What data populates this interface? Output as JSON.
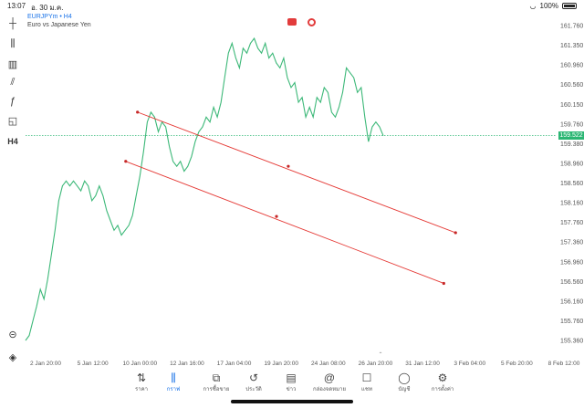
{
  "status": {
    "time": "13:07",
    "date": "อ. 30 ม.ค.",
    "battery": "100%"
  },
  "header": {
    "symbol": "EURJPYm • H4",
    "description": "Euro vs Japanese Yen"
  },
  "toolbar": [
    {
      "name": "crosshair-icon",
      "glyph": "┼"
    },
    {
      "name": "candles-icon",
      "glyph": "⫼"
    },
    {
      "name": "indicators-icon",
      "glyph": "▥"
    },
    {
      "name": "objects-icon",
      "glyph": "⫽"
    },
    {
      "name": "function-icon",
      "glyph": "ƒ"
    },
    {
      "name": "shapes-icon",
      "glyph": "◱"
    },
    {
      "name": "timeframe-button",
      "glyph": "H4"
    }
  ],
  "current_price": "159.522",
  "x_labels": [
    "2 Jan 20:00",
    "5 Jan 12:00",
    "10 Jan 00:00",
    "12 Jan 16:00",
    "17 Jan 04:00",
    "19 Jan 20:00",
    "24 Jan 08:00",
    "26 Jan 20:00",
    "31 Jan 12:00",
    "3 Feb 04:00",
    "5 Feb 20:00",
    "8 Feb 12:00"
  ],
  "y_labels": [
    "161.760",
    "161.350",
    "160.960",
    "160.560",
    "160.150",
    "159.760",
    "159.380",
    "158.960",
    "158.560",
    "158.160",
    "157.760",
    "157.360",
    "156.960",
    "156.560",
    "156.160",
    "155.760",
    "155.360"
  ],
  "chart_data": {
    "type": "line",
    "y_range": [
      155.36,
      161.76
    ],
    "series": [
      {
        "values": [
          155.36,
          155.46,
          155.76,
          156.05,
          156.4,
          156.2,
          156.6,
          157.1,
          157.6,
          158.2,
          158.5,
          158.6,
          158.5,
          158.6,
          158.5,
          158.4,
          158.6,
          158.5,
          158.2,
          158.3,
          158.5,
          158.3,
          158.0,
          157.8,
          157.6,
          157.7,
          157.5,
          157.6,
          157.7,
          157.9,
          158.3,
          158.7,
          159.2,
          159.8,
          160.0,
          159.9,
          159.6,
          159.8,
          159.7,
          159.3,
          159.0,
          158.9,
          159.0,
          158.8,
          158.9,
          159.1,
          159.4,
          159.6,
          159.7,
          159.9,
          159.8,
          160.1,
          159.9,
          160.2,
          160.7,
          161.2,
          161.4,
          161.1,
          160.9,
          161.3,
          161.2,
          161.4,
          161.5,
          161.3,
          161.2,
          161.4,
          161.1,
          161.2,
          161.0,
          160.9,
          161.1,
          160.7,
          160.5,
          160.6,
          160.2,
          160.3,
          159.9,
          160.1,
          159.9,
          160.3,
          160.2,
          160.5,
          160.4,
          160.0,
          159.9,
          160.1,
          160.4,
          160.9,
          160.8,
          160.7,
          160.4,
          160.5,
          159.9,
          159.4,
          159.7,
          159.8,
          159.7,
          159.52
        ]
      }
    ],
    "trendlines": [
      {
        "from": {
          "x": "9 Jan 08:00",
          "y": 160.0
        },
        "mid": {
          "x": "20 Jan 00:00",
          "y": 158.9
        },
        "to": {
          "x": "31 Jan 20:00",
          "y": 157.55
        }
      },
      {
        "from": {
          "x": "8 Jan 12:00",
          "y": 159.0
        },
        "mid": {
          "x": "19 Jan 04:00",
          "y": 157.88
        },
        "to": {
          "x": "31 Jan 00:00",
          "y": 156.52
        }
      }
    ]
  },
  "nav": [
    {
      "name": "nav-quotes",
      "icon": "⇅",
      "label": "ราคา"
    },
    {
      "name": "nav-chart",
      "icon": "⫼",
      "label": "กราฟ",
      "active": true
    },
    {
      "name": "nav-trade",
      "icon": "⧉",
      "label": "การซื้อขาย"
    },
    {
      "name": "nav-history",
      "icon": "↺",
      "label": "ประวัติ"
    },
    {
      "name": "nav-news",
      "icon": "▤",
      "label": "ข่าว"
    },
    {
      "name": "nav-mailbox",
      "icon": "@",
      "label": "กล่องจดหมาย"
    },
    {
      "name": "nav-chat",
      "icon": "☐",
      "label": "แชท"
    },
    {
      "name": "nav-account",
      "icon": "◯",
      "label": "บัญชี"
    },
    {
      "name": "nav-settings",
      "icon": "⚙",
      "label": "การตั้งค่า"
    }
  ]
}
